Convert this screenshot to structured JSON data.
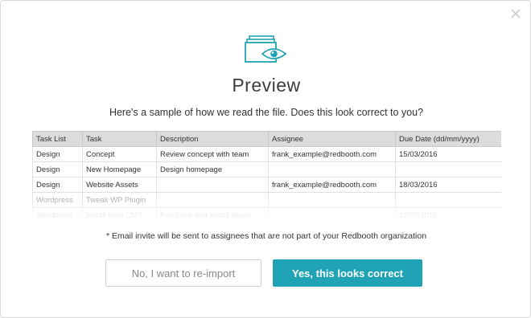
{
  "modal": {
    "title": "Preview",
    "subtitle": "Here's a sample of how we read the file. Does this look correct to you?",
    "note": "* Email invite will be sent to assignees that are not part of your Redbooth organization",
    "icon": "file-preview-eye-icon",
    "close_icon": "close-icon",
    "accent_color": "#21a3b6"
  },
  "table": {
    "headers": [
      "Task List",
      "Task",
      "Description",
      "Assignee",
      "Due Date (dd/mm/yyyy)"
    ],
    "rows": [
      [
        "Design",
        "Concept",
        "Review concept with team",
        "frank_example@redbooth.com",
        "15/03/2016"
      ],
      [
        "Design",
        "New Homepage",
        "Design homepage",
        "",
        ""
      ],
      [
        "Design",
        "Website Assets",
        "",
        "frank_example@redbooth.com",
        "18/03/2016"
      ],
      [
        "Wordpress",
        "Tweak WP Plugin",
        "",
        "",
        ""
      ],
      [
        "Wordpress",
        "Install New CMS",
        "Purchase and install plugin",
        "",
        "22/03/2016"
      ]
    ]
  },
  "buttons": {
    "reimport": "No, I want to re-import",
    "confirm": "Yes, this looks correct"
  }
}
